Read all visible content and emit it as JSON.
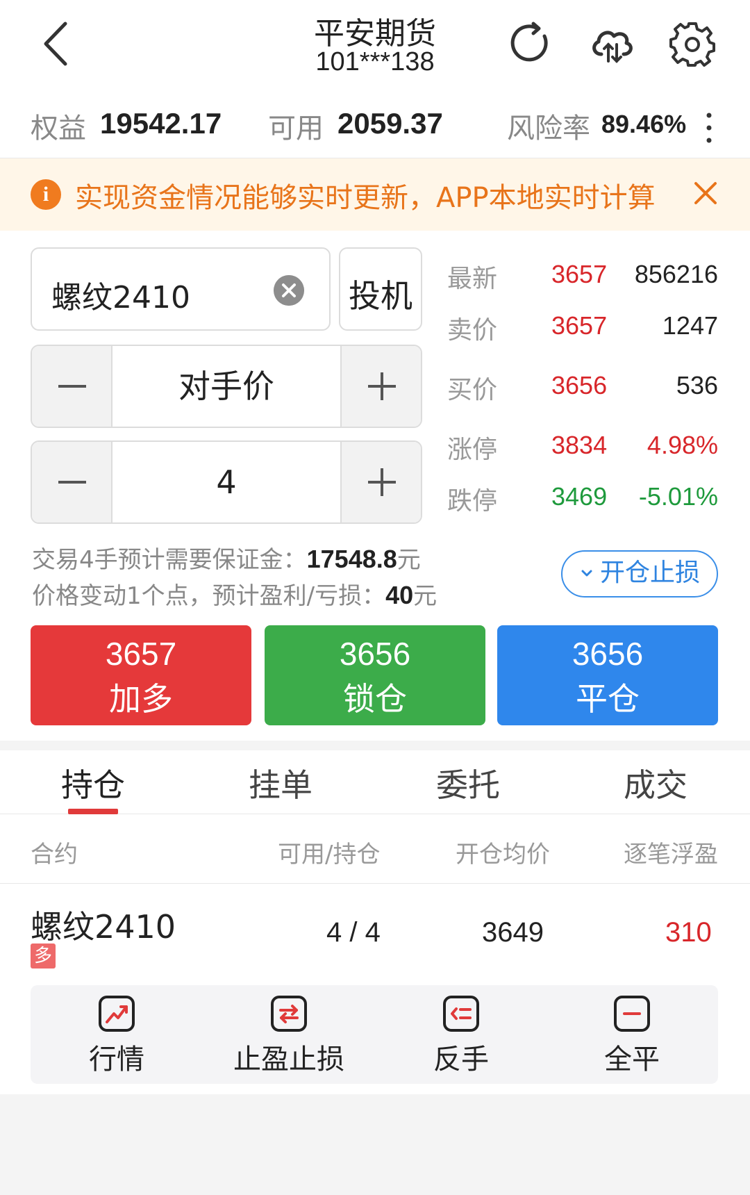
{
  "header": {
    "title": "平安期货",
    "account": "101***138"
  },
  "summary": {
    "equity_label": "权益",
    "equity_value": "19542.17",
    "available_label": "可用",
    "available_value": "2059.37",
    "risk_label": "风险率",
    "risk_value": "89.46%"
  },
  "notice": {
    "text": "实现资金情况能够实时更新，APP本地实时计算"
  },
  "order": {
    "contract": "螺纹2410",
    "type": "投机",
    "price_mode": "对手价",
    "quantity": "4"
  },
  "quotes": [
    {
      "label": "最新",
      "price": "3657",
      "value": "856216",
      "price_color": "#d8262a",
      "value_color": "#222222"
    },
    {
      "label": "卖价",
      "price": "3657",
      "value": "1247",
      "price_color": "#d8262a",
      "value_color": "#222222"
    },
    {
      "label": "买价",
      "price": "3656",
      "value": "536",
      "price_color": "#d8262a",
      "value_color": "#222222"
    },
    {
      "label": "涨停",
      "price": "3834",
      "value": "4.98%",
      "price_color": "#d8262a",
      "value_color": "#d8262a"
    },
    {
      "label": "跌停",
      "price": "3469",
      "value": "-5.01%",
      "price_color": "#1e9a3c",
      "value_color": "#1e9a3c"
    }
  ],
  "info": {
    "margin_label": "交易4手预计需要保证金：",
    "margin_value": "17548.8",
    "margin_unit": "元",
    "pnl_label": "价格变动1个点，预计盈利/亏损：",
    "pnl_value": "40",
    "pnl_unit": "元",
    "stoploss": "开仓止损"
  },
  "trade_buttons": {
    "long_price": "3657",
    "long_label": "加多",
    "long_color": "#e5393a",
    "lock_price": "3656",
    "lock_label": "锁仓",
    "lock_color": "#3cac4a",
    "close_price": "3656",
    "close_label": "平仓",
    "close_color": "#2f87ec"
  },
  "tabs": [
    "持仓",
    "挂单",
    "委托",
    "成交"
  ],
  "table": {
    "headers": [
      "合约",
      "可用/持仓",
      "开仓均价",
      "逐笔浮盈"
    ],
    "rows": [
      {
        "contract": "螺纹2410",
        "direction": "多",
        "available_hold": "4 / 4",
        "avg_price": "3649",
        "float_pnl": "310"
      }
    ]
  },
  "actions": [
    {
      "label": "行情",
      "icon": "chart-trend-icon"
    },
    {
      "label": "止盈止损",
      "icon": "exchange-icon"
    },
    {
      "label": "反手",
      "icon": "reverse-icon"
    },
    {
      "label": "全平",
      "icon": "minus-icon"
    }
  ]
}
